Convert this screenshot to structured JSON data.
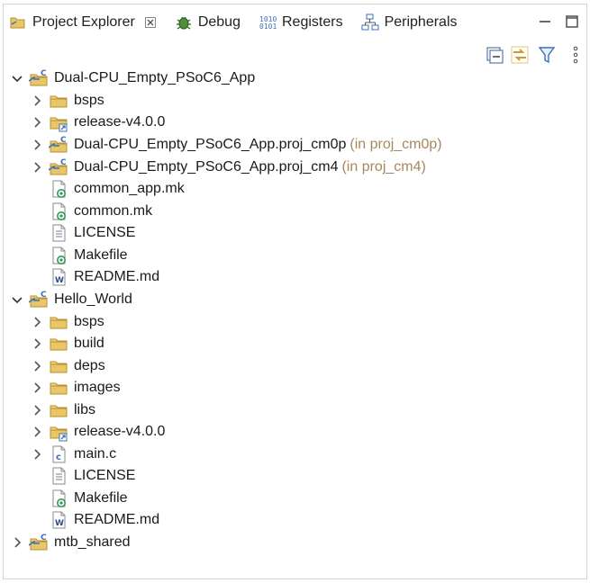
{
  "tabs": [
    {
      "label": "Project Explorer",
      "icon": "project-explorer-icon",
      "active": true
    },
    {
      "label": "Debug",
      "icon": "debug-bug-icon"
    },
    {
      "label": "Registers",
      "icon": "registers-binary-icon"
    },
    {
      "label": "Peripherals",
      "icon": "peripherals-tree-icon"
    }
  ],
  "colors": {
    "folder": "#e8c66a",
    "folder_stroke": "#b8902e",
    "project_blue": "#3f6fb5",
    "decoration": "#a8875c",
    "make_green": "#2e9a5a"
  },
  "tree": {
    "root1": {
      "label": "Dual-CPU_Empty_PSoC6_App",
      "children": {
        "bsps": "bsps",
        "release": "release-v4.0.0",
        "cm0p": {
          "label": "Dual-CPU_Empty_PSoC6_App.proj_cm0p",
          "decoration": "(in proj_cm0p)"
        },
        "cm4": {
          "label": "Dual-CPU_Empty_PSoC6_App.proj_cm4",
          "decoration": "(in proj_cm4)"
        },
        "common_app": "common_app.mk",
        "common": "common.mk",
        "license": "LICENSE",
        "makefile": "Makefile",
        "readme": "README.md"
      }
    },
    "root2": {
      "label": "Hello_World",
      "children": {
        "bsps": "bsps",
        "build": "build",
        "deps": "deps",
        "images": "images",
        "libs": "libs",
        "release": "release-v4.0.0",
        "main": "main.c",
        "license": "LICENSE",
        "makefile": "Makefile",
        "readme": "README.md"
      }
    },
    "root3": {
      "label": "mtb_shared"
    }
  }
}
